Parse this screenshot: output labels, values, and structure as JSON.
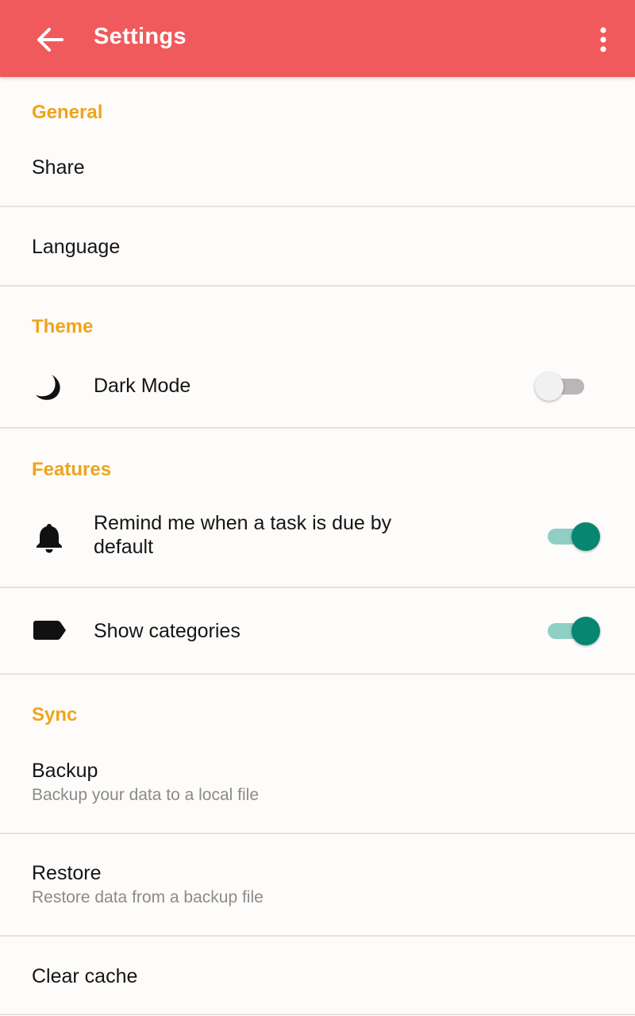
{
  "appbar": {
    "title": "Settings",
    "back_icon": "arrow-left-icon",
    "overflow_icon": "more-vert-icon",
    "color": "#f05a5c"
  },
  "colors": {
    "section_title": "#eea41c",
    "switch_on": "#078672"
  },
  "sections": {
    "general": {
      "title": "General",
      "share": "Share",
      "language": "Language"
    },
    "theme": {
      "title": "Theme",
      "dark_mode": {
        "label": "Dark Mode",
        "icon": "moon-icon",
        "enabled": false
      }
    },
    "features": {
      "title": "Features",
      "remind": {
        "label_line1": "Remind me when a task is due by",
        "label_line2": "default",
        "icon": "bell-icon",
        "enabled": true
      },
      "categories": {
        "label": "Show categories",
        "icon": "label-icon",
        "enabled": true
      }
    },
    "sync": {
      "title": "Sync",
      "backup": {
        "label": "Backup",
        "subtitle": "Backup your data to a local file"
      },
      "restore": {
        "label": "Restore",
        "subtitle": "Restore data from a backup file"
      },
      "clear_cache": {
        "label": "Clear cache"
      }
    }
  }
}
